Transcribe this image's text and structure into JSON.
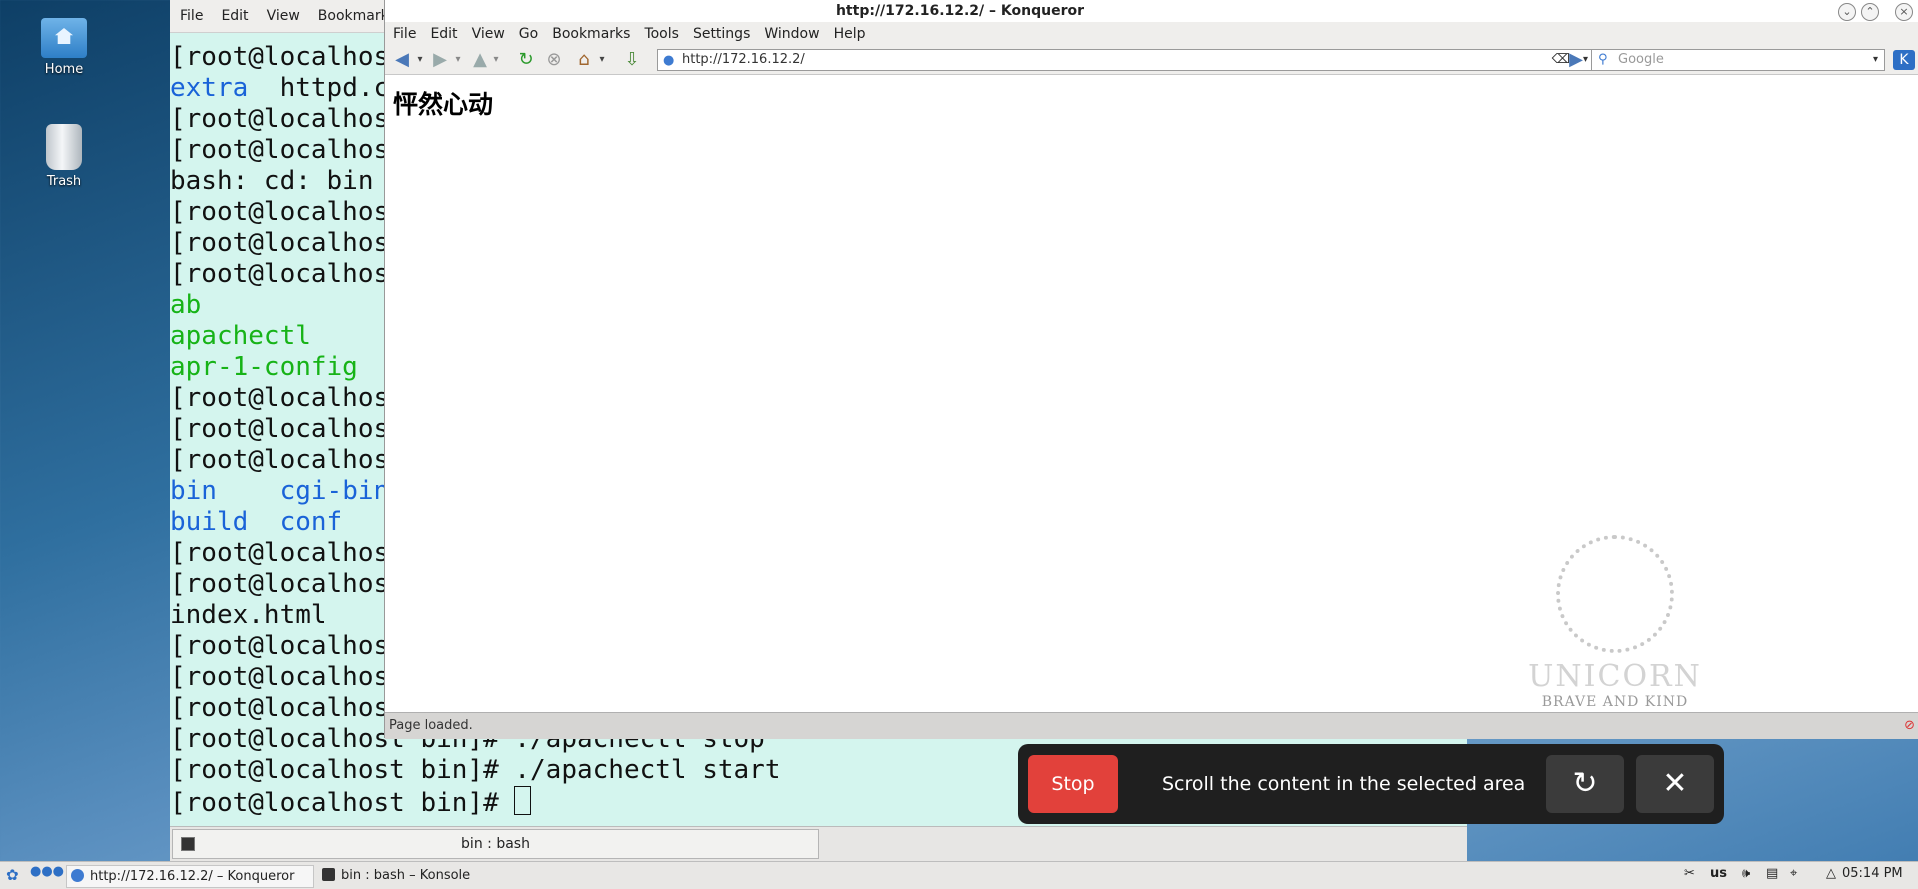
{
  "desktop": {
    "icons": [
      {
        "label": "Home"
      },
      {
        "label": "Trash"
      }
    ]
  },
  "konsole": {
    "menu": [
      "File",
      "Edit",
      "View",
      "Bookmarks"
    ],
    "lines": [
      [
        {
          "t": "[root@localhos",
          "c": ""
        }
      ],
      [
        {
          "t": "extra",
          "c": "blue"
        },
        {
          "t": "  httpd.c",
          "c": ""
        }
      ],
      [
        {
          "t": "[root@localhos",
          "c": ""
        }
      ],
      [
        {
          "t": "[root@localhos",
          "c": ""
        }
      ],
      [
        {
          "t": "bash: cd: bin",
          "c": ""
        }
      ],
      [
        {
          "t": "[root@localhos",
          "c": ""
        }
      ],
      [
        {
          "t": "[root@localhos",
          "c": ""
        }
      ],
      [
        {
          "t": "[root@localhos",
          "c": ""
        }
      ],
      [
        {
          "t": "ab",
          "c": "green"
        }
      ],
      [
        {
          "t": "apachectl",
          "c": "green"
        }
      ],
      [
        {
          "t": "apr-1-config",
          "c": "green"
        }
      ],
      [
        {
          "t": "[root@localhos",
          "c": ""
        }
      ],
      [
        {
          "t": "[root@localhos",
          "c": ""
        }
      ],
      [
        {
          "t": "[root@localhos",
          "c": ""
        }
      ],
      [
        {
          "t": "bin",
          "c": "blue"
        },
        {
          "t": "    ",
          "c": ""
        },
        {
          "t": "cgi-bin",
          "c": "blue"
        }
      ],
      [
        {
          "t": "build",
          "c": "blue"
        },
        {
          "t": "  ",
          "c": ""
        },
        {
          "t": "conf",
          "c": "blue"
        }
      ],
      [
        {
          "t": "[root@localhos",
          "c": ""
        }
      ],
      [
        {
          "t": "[root@localhos",
          "c": ""
        }
      ],
      [
        {
          "t": "index.html",
          "c": ""
        }
      ],
      [
        {
          "t": "[root@localhos",
          "c": ""
        }
      ],
      [
        {
          "t": "[root@localhos",
          "c": ""
        }
      ],
      [
        {
          "t": "[root@localhos",
          "c": ""
        }
      ],
      [
        {
          "t": "[root@localhost bin]# ./apachectl stop",
          "c": ""
        }
      ],
      [
        {
          "t": "[root@localhost bin]# ./apachectl start",
          "c": ""
        }
      ],
      [
        {
          "t": "[root@localhost bin]# ",
          "c": ""
        }
      ]
    ],
    "tab_label": "bin : bash"
  },
  "konqueror": {
    "title": "http://172.16.12.2/ – Konqueror",
    "menu": [
      "File",
      "Edit",
      "View",
      "Go",
      "Bookmarks",
      "Tools",
      "Settings",
      "Window",
      "Help"
    ],
    "url": "http://172.16.12.2/",
    "search_placeholder": "Google",
    "page_heading": "怦然心动",
    "status": "Page loaded.",
    "emblem_name": "UNICORN",
    "emblem_motto": "BRAVE AND KIND"
  },
  "scroll_helper": {
    "stop_label": "Stop",
    "message": "Scroll the content in the selected area"
  },
  "panel": {
    "tasks": [
      "http://172.16.12.2/ – Konqueror",
      "bin : bash – Konsole"
    ],
    "keyboard": "us",
    "clock": "05:14 PM"
  },
  "colors": {
    "accent": "#e2413b",
    "terminal_bg": "#d4f5ee",
    "ls_dir": "#1a63d8",
    "ls_exec": "#17b317"
  }
}
